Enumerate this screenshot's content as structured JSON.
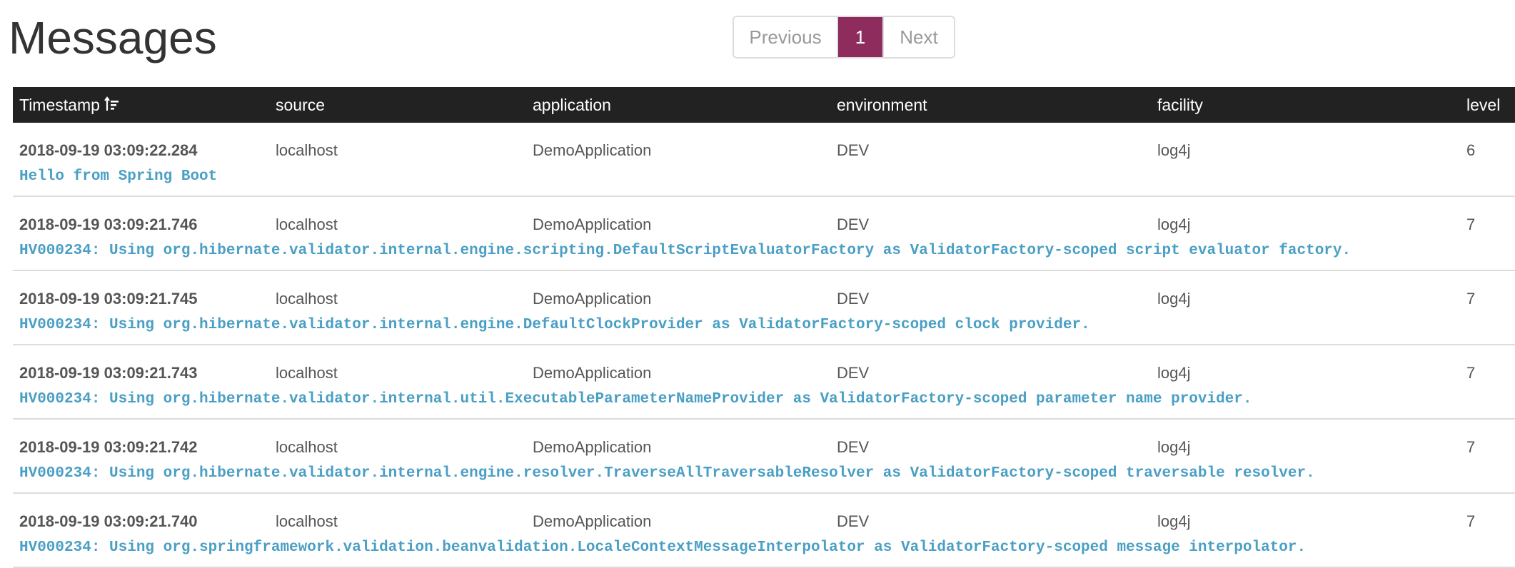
{
  "page": {
    "title": "Messages"
  },
  "pagination": {
    "previous": "Previous",
    "current": "1",
    "next": "Next",
    "accent_color": "#8e2c5d"
  },
  "table": {
    "headers": {
      "timestamp": "Timestamp",
      "source": "source",
      "application": "application",
      "environment": "environment",
      "facility": "facility",
      "level": "level"
    },
    "sort_icon": "sort-descending-icon",
    "rows": [
      {
        "timestamp": "2018-09-19 03:09:22.284",
        "source": "localhost",
        "application": "DemoApplication",
        "environment": "DEV",
        "facility": "log4j",
        "level": "6",
        "message": "Hello from Spring Boot"
      },
      {
        "timestamp": "2018-09-19 03:09:21.746",
        "source": "localhost",
        "application": "DemoApplication",
        "environment": "DEV",
        "facility": "log4j",
        "level": "7",
        "message": "HV000234: Using org.hibernate.validator.internal.engine.scripting.DefaultScriptEvaluatorFactory as ValidatorFactory-scoped script evaluator factory."
      },
      {
        "timestamp": "2018-09-19 03:09:21.745",
        "source": "localhost",
        "application": "DemoApplication",
        "environment": "DEV",
        "facility": "log4j",
        "level": "7",
        "message": "HV000234: Using org.hibernate.validator.internal.engine.DefaultClockProvider as ValidatorFactory-scoped clock provider."
      },
      {
        "timestamp": "2018-09-19 03:09:21.743",
        "source": "localhost",
        "application": "DemoApplication",
        "environment": "DEV",
        "facility": "log4j",
        "level": "7",
        "message": "HV000234: Using org.hibernate.validator.internal.util.ExecutableParameterNameProvider as ValidatorFactory-scoped parameter name provider."
      },
      {
        "timestamp": "2018-09-19 03:09:21.742",
        "source": "localhost",
        "application": "DemoApplication",
        "environment": "DEV",
        "facility": "log4j",
        "level": "7",
        "message": "HV000234: Using org.hibernate.validator.internal.engine.resolver.TraverseAllTraversableResolver as ValidatorFactory-scoped traversable resolver."
      },
      {
        "timestamp": "2018-09-19 03:09:21.740",
        "source": "localhost",
        "application": "DemoApplication",
        "environment": "DEV",
        "facility": "log4j",
        "level": "7",
        "message": "HV000234: Using org.springframework.validation.beanvalidation.LocaleContextMessageInterpolator as ValidatorFactory-scoped message interpolator."
      }
    ]
  }
}
